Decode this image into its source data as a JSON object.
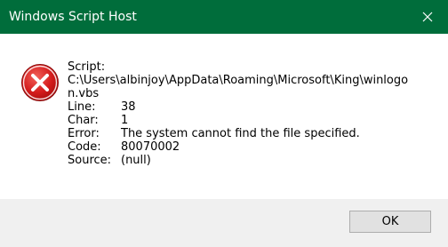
{
  "window": {
    "title": "Windows Script Host",
    "close_icon": "close-icon",
    "titlebar_color": "#006d3b"
  },
  "message": {
    "icon": "error-icon",
    "script_label": "Script:",
    "script_path_line1": "C:\\Users\\albinjoy\\AppData\\Roaming\\Microsoft\\King\\winlogo",
    "script_path_line2": "n.vbs",
    "line_label": "Line:",
    "line_value": "38",
    "char_label": "Char:",
    "char_value": "1",
    "error_label": "Error:",
    "error_value": "The system cannot find the file specified.",
    "code_label": "Code:",
    "code_value": "80070002",
    "source_label": "Source:",
    "source_value": "(null)"
  },
  "footer": {
    "ok_label": "OK"
  }
}
